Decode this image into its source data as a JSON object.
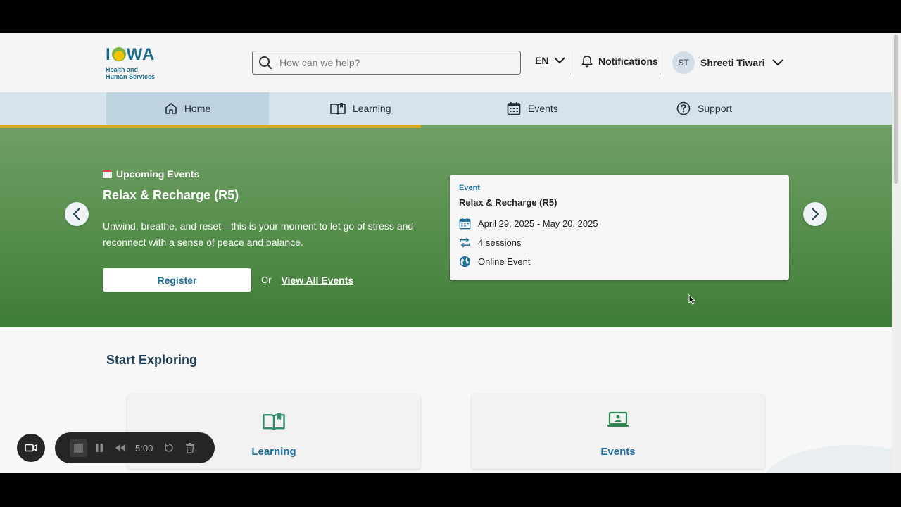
{
  "header": {
    "logo_word": "IOWA",
    "logo_sub_1": "Health and",
    "logo_sub_2": "Human Services",
    "search_placeholder": "How can we help?",
    "language": "EN",
    "notifications_label": "Notifications",
    "user_initials": "ST",
    "user_name": "Shreeti Tiwari"
  },
  "nav": {
    "items": [
      {
        "label": "Home",
        "icon": "home-icon",
        "active": true
      },
      {
        "label": "Learning",
        "icon": "book-icon"
      },
      {
        "label": "Events",
        "icon": "calendar-icon"
      },
      {
        "label": "Support",
        "icon": "help-circle-icon"
      }
    ]
  },
  "hero": {
    "section_label": "Upcoming Events",
    "title": "Relax & Recharge (R5)",
    "description": "Unwind, breathe, and reset—this is your moment to let go of stress and reconnect with a sense of peace and balance.",
    "register_label": "Register",
    "or_label": "Or",
    "view_all_label": "View All Events",
    "accent_color": "#e0a320",
    "event_card": {
      "tag": "Event",
      "title": "Relax & Recharge (R5)",
      "dates": "April 29, 2025 - May 20, 2025",
      "sessions": "4 sessions",
      "location": "Online Event"
    }
  },
  "explore": {
    "title": "Start Exploring",
    "tiles": [
      {
        "label": "Learning",
        "icon": "book-icon"
      },
      {
        "label": "Events",
        "icon": "laptop-presentation-icon"
      }
    ]
  },
  "recorder": {
    "time": "5:00"
  }
}
